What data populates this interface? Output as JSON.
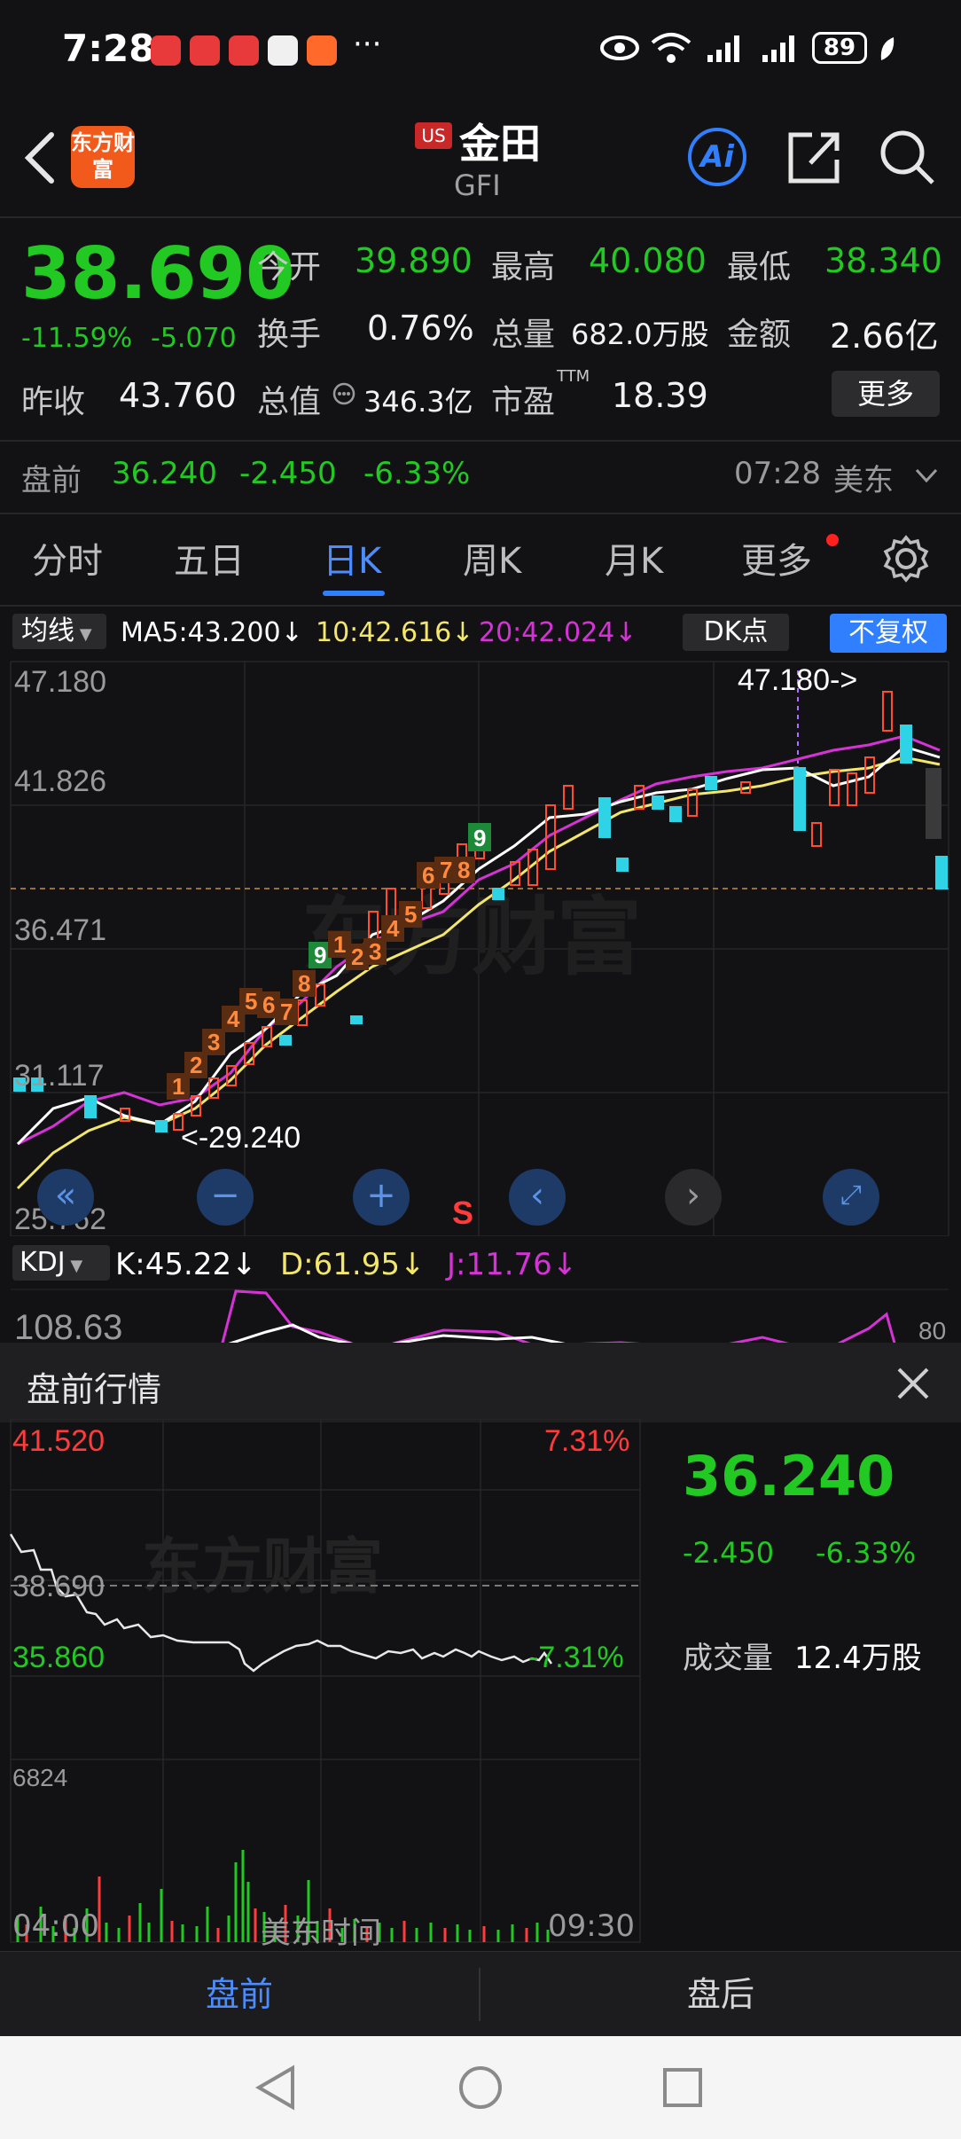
{
  "status_bar": {
    "time": "7:28",
    "battery": "89",
    "more": "···"
  },
  "header": {
    "logo_text": "东方财富",
    "market_badge": "US",
    "name": "金田",
    "code": "GFI",
    "ai_label": "Ai"
  },
  "quote": {
    "price": "38.690",
    "change_pct": "-11.59%",
    "change": "-5.070",
    "open_label": "今开",
    "open": "39.890",
    "high_label": "最高",
    "high": "40.080",
    "low_label": "最低",
    "low": "38.340",
    "turnover_label": "换手",
    "turnover": "0.76%",
    "volume_label": "总量",
    "volume": "682.0万股",
    "amount_label": "金额",
    "amount": "2.66亿",
    "prev_close_label": "昨收",
    "prev_close": "43.760",
    "mcap_label": "总值",
    "mcap": "346.3亿",
    "pe_label": "市盈",
    "pe_sup": "TTM",
    "pe": "18.39",
    "more_button": "更多"
  },
  "premarket_row": {
    "label": "盘前",
    "price": "36.240",
    "change": "-2.450",
    "pct": "-6.33%",
    "time": "07:28",
    "market": "美东"
  },
  "tabs": [
    "分时",
    "五日",
    "日K",
    "周K",
    "月K",
    "更多"
  ],
  "active_tab": "日K",
  "ma_bar": {
    "label": "均线",
    "ma5": "MA5:43.200↓",
    "ma10": "10:42.616↓",
    "ma20": "20:42.024↓",
    "dk": "DK点",
    "fq": "不复权"
  },
  "kline": {
    "y_labels": [
      "47.180",
      "41.826",
      "36.471",
      "31.117",
      "25.762"
    ],
    "high_note": "47.180->",
    "low_note": "<-29.240",
    "signal": "S",
    "td_up": [
      "1",
      "2",
      "3",
      "4",
      "5",
      "6",
      "7",
      "8",
      "9"
    ],
    "td_up2": [
      "1",
      "2",
      "3",
      "4",
      "5",
      "6",
      "7",
      "8",
      "9"
    ]
  },
  "kdj": {
    "label": "KDJ",
    "k": "K:45.22↓",
    "d": "D:61.95↓",
    "j": "J:11.76↓",
    "top": "108.63",
    "right": "80"
  },
  "panel": {
    "title": "盘前行情",
    "high": "41.520",
    "mid": "38.690",
    "low": "35.860",
    "pct_high": "7.31%",
    "pct_low": "-7.31%",
    "vol_max": "6824",
    "t_start": "04:00",
    "t_mid": "美东时间",
    "t_end": "09:30",
    "price": "36.240",
    "change": "-2.450",
    "pct": "-6.33%",
    "vol_label": "成交量",
    "vol": "12.4万股",
    "watermark": "东方财富"
  },
  "bottom_tabs": [
    "盘前",
    "盘后"
  ],
  "colors": {
    "up": "#ff3b3b",
    "down": "#22c922",
    "accent": "#2f7fff",
    "ma5": "#ffffff",
    "ma10": "#f2e66b",
    "ma20": "#d633d6"
  }
}
